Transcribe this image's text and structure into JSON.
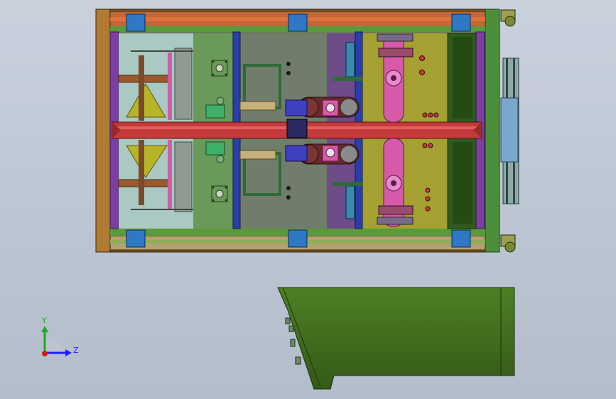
{
  "viewport": {
    "background_top": "#c9d1dd",
    "background_bottom": "#b3bdcb"
  },
  "model": {
    "frame_color": "#b0742a",
    "frame_dark": "#6b4414",
    "frame_blue": "#2a3fa8",
    "green_panel": "#3b6b1e",
    "purple_panel": "#7a3fa0",
    "olive_panel": "#8f8f2a",
    "red_beam": "#c43a3a",
    "pink_part": "#d65aa8",
    "connector_blue": "#2f78c4",
    "hopper_yellow": "#b7b427"
  },
  "side_view": {
    "color": "#3f6a1d",
    "edge": "#1d3010"
  },
  "triad": {
    "y_label": "Y",
    "z_label": "Z",
    "y_color": "#1faa1f",
    "z_color": "#1c1cff",
    "origin_color": "#d11a1a"
  }
}
